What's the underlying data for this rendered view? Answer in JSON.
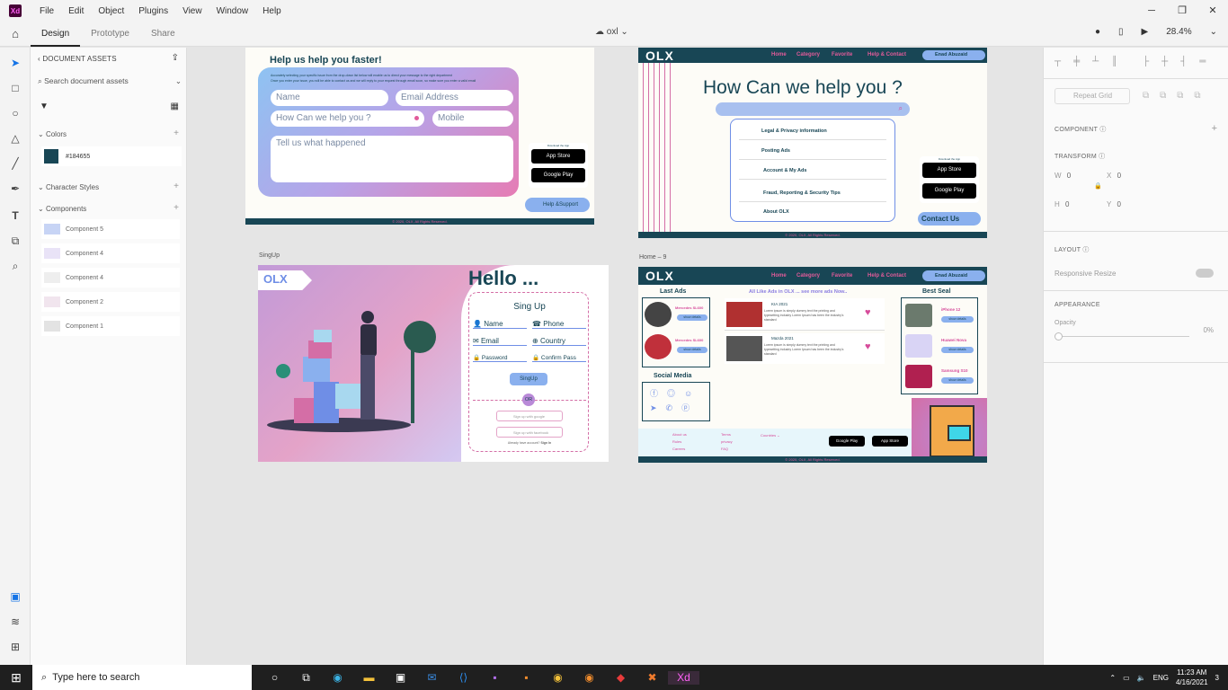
{
  "menubar": {
    "logo": "Xd",
    "items": [
      "File",
      "Edit",
      "Object",
      "Plugins",
      "View",
      "Window",
      "Help"
    ]
  },
  "toolbar": {
    "tabs": [
      "Design",
      "Prototype",
      "Share"
    ],
    "doc_name": "oxl",
    "zoom": "28.4%"
  },
  "assets": {
    "header": "DOCUMENT ASSETS",
    "search_placeholder": "Search document assets",
    "colors_label": "Colors",
    "color_hex": "#184655",
    "character_styles_label": "Character Styles",
    "components_label": "Components",
    "components": [
      "Component 5",
      "Component 4",
      "Component 4",
      "Component 2",
      "Component 1"
    ]
  },
  "artboards": {
    "help": {
      "title": "Help us help you faster!",
      "sub1": "Accurately selecting your specific issue from the drop-down list below will enable us to direct your message to the right department",
      "sub2": "Once you enter your issue, you will be able to contact us and we will reply to your request through email soon, so make sure you enter a valid email",
      "name": "Name",
      "email": "Email Address",
      "question": "How Can we help you ?",
      "mobile": "Mobile",
      "message": "Tell us what happened",
      "download": "Download the App",
      "appstore": "App Store",
      "appstore_small": "Download on the",
      "googleplay": "Google Play",
      "googleplay_small": "GET IT ON",
      "support": "Help &Support",
      "footer": "© 2020, OLX, All Rights Reserved."
    },
    "helpus": {
      "logo": "OLX",
      "nav": [
        "Home",
        "Category",
        "Favorite",
        "Help & Contact"
      ],
      "user": "Enad Abuzaid",
      "title": "How Can we help you ?",
      "items": [
        "Legal & Privacy information",
        "Posting Ads",
        "Account & My Ads",
        "Fraud, Reporting & Security Tips",
        "About OLX"
      ],
      "download": "Download the App",
      "contact": "Contact Us",
      "footer": "© 2020, OLX, All Rights Reserved."
    },
    "signup": {
      "label": "SingUp",
      "hello": "Hello ...",
      "form_title": "Sing Up",
      "name": "Name",
      "phone": "Phone",
      "email": "Email",
      "country": "Country",
      "password": "Password",
      "confirm": "Confirm Pass",
      "button": "SingUp",
      "or": "OR",
      "google": "Sign up with google",
      "facebook": "Sign up with facebook",
      "have_account": "Already have account?",
      "signin": "Sign In"
    },
    "home": {
      "label": "Home – 9",
      "last_ads": "Last Ads",
      "car": "Mercedes SL600",
      "show": "show details",
      "all_ads": "All Like Ads in OLX ... see more ads Now..",
      "ad1": "KIA 2021",
      "ad2": "Mazda 2021",
      "lorem": "Lorem ipsum is simply dummy text the printing and typesetting industry Lorem Ipsum has been the industry's standard",
      "best": "Best Seal",
      "phones": [
        "iPhone 12",
        "Huawei Nova",
        "Samsung S10"
      ],
      "social": "Social Media",
      "footer_links1": [
        "About us",
        "Rules",
        "Careers"
      ],
      "footer_links2": [
        "Terms",
        "privacy",
        "FAQ"
      ],
      "countries": "Countries",
      "copyright": "© 2020, OLX, All Rights Reserved."
    }
  },
  "right_panel": {
    "repeat_grid": "Repeat Grid",
    "component": "COMPONENT",
    "transform": "TRANSFORM",
    "w": "W",
    "w_val": "0",
    "x": "X",
    "x_val": "0",
    "h": "H",
    "h_val": "0",
    "y": "Y",
    "y_val": "0",
    "layout": "LAYOUT",
    "responsive": "Responsive Resize",
    "appearance": "APPEARANCE",
    "opacity": "Opacity",
    "opacity_val": "0%"
  },
  "taskbar": {
    "search": "Type here to search",
    "lang": "ENG",
    "time": "11:23 AM",
    "date": "4/16/2021",
    "notif": "3"
  }
}
